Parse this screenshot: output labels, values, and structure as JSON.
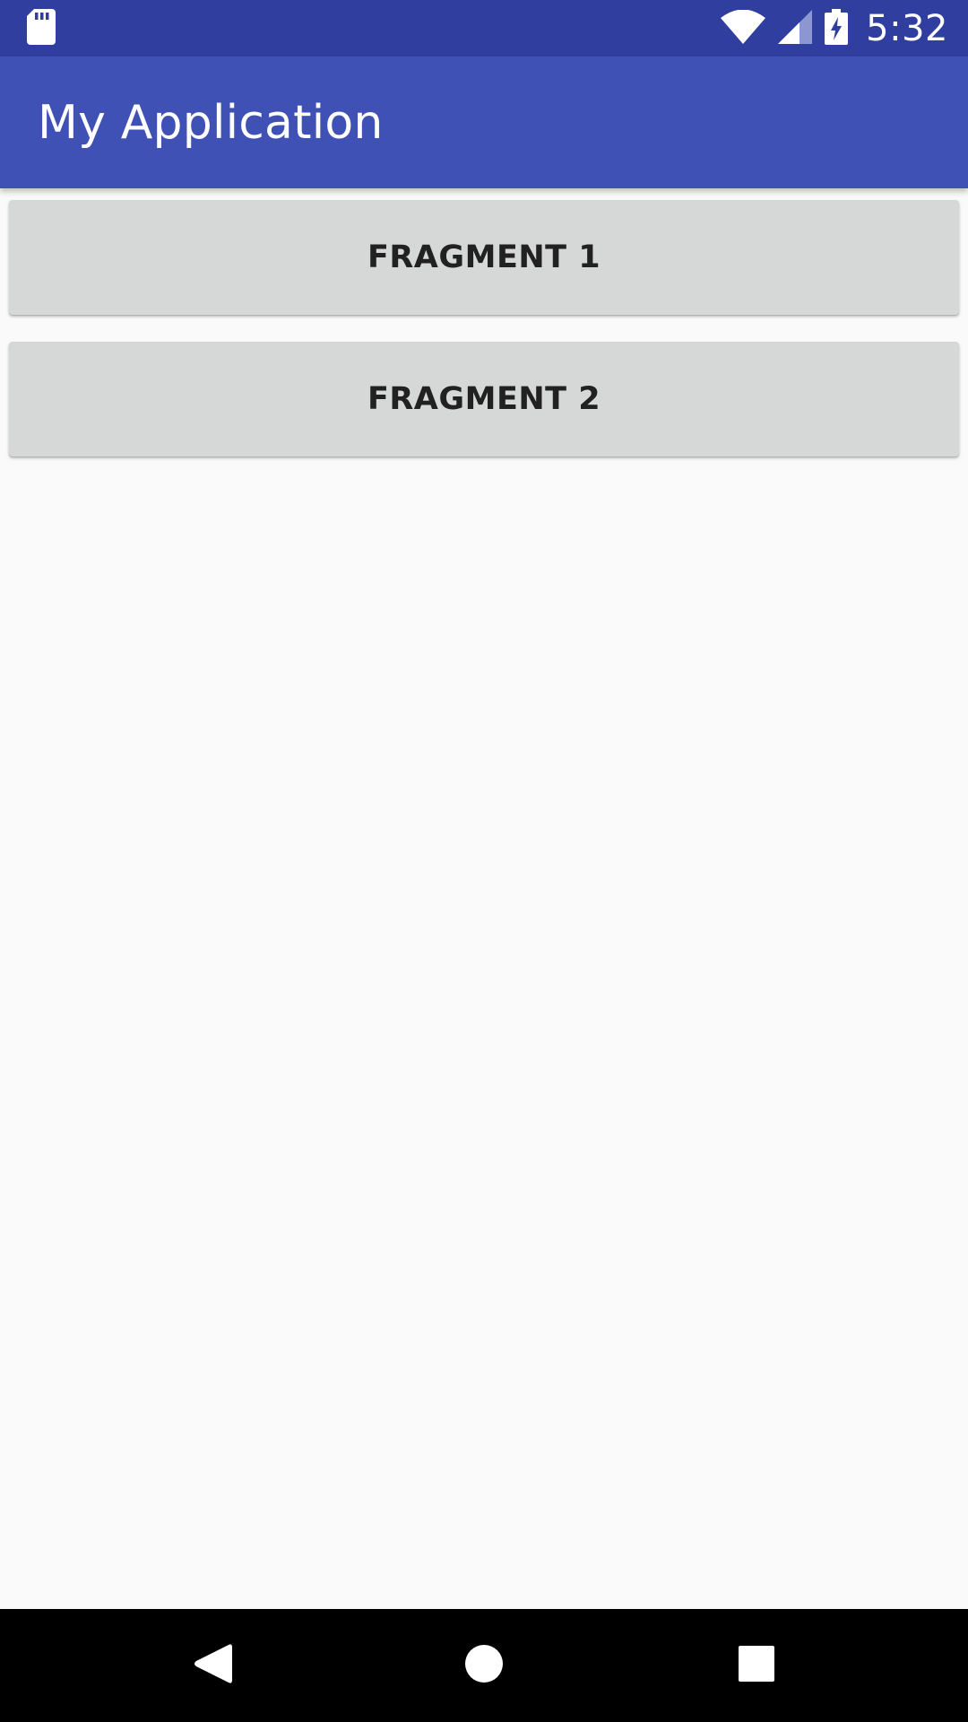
{
  "status_bar": {
    "time": "5:32",
    "icons": {
      "left": "sd-card-icon",
      "right": [
        "wifi-icon",
        "cell-signal-icon",
        "battery-charging-icon"
      ]
    },
    "color": "#303f9f"
  },
  "app_bar": {
    "title": "My Application",
    "color": "#3f51b5"
  },
  "buttons": {
    "fragment1_label": "FRAGMENT 1",
    "fragment2_label": "FRAGMENT 2"
  },
  "nav_bar": {
    "icons": [
      "back-icon",
      "home-icon",
      "recents-icon"
    ]
  }
}
